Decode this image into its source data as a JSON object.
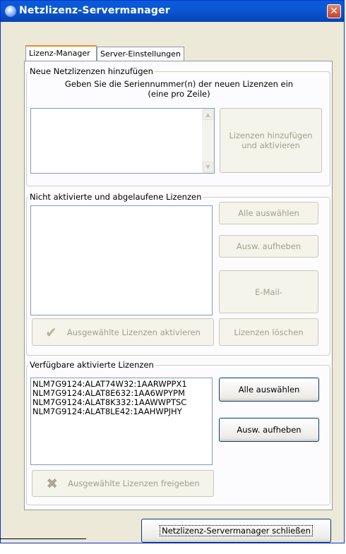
{
  "window": {
    "title": "Netzlizenz-Servermanager",
    "close_glyph": "✕"
  },
  "tabs": [
    {
      "label": "Lizenz-Manager",
      "active": true
    },
    {
      "label": "Server-Einstellungen",
      "active": false
    }
  ],
  "new_licenses": {
    "legend": "Neue Netzlizenzen hinzufügen",
    "instruction_line1": "Geben Sie die Seriennummer(n) der neuen Lizenzen ein",
    "instruction_line2": "(eine pro Zeile)",
    "input_value": "",
    "add_button_line1": "Lizenzen hinzufügen",
    "add_button_line2": "und aktivieren"
  },
  "inactive_licenses": {
    "legend": "Nicht aktivierte und abgelaufene Lizenzen",
    "items": [],
    "select_all_button": "Alle auswählen",
    "deselect_button": "Ausw. aufheben",
    "email_button": "E-Mail-",
    "activate_button": "Ausgewählte Lizenzen aktivieren",
    "delete_button": "Lizenzen löschen"
  },
  "active_licenses": {
    "legend": "Verfügbare aktivierte Lizenzen",
    "items": [
      "NLM7G9124:ALAT74W32:1AARWPPX1",
      "NLM7G9124:ALAT8E632:1AA6WPYPM",
      "NLM7G9124:ALAT8K332:1AAWWPTSC",
      "NLM7G9124:ALAT8LE42:1AAHWPJHY"
    ],
    "select_all_button": "Alle auswählen",
    "deselect_button": "Ausw. aufheben",
    "release_button": "Ausgewählte Lizenzen freigeben"
  },
  "footer": {
    "close_button": "Netzlizenz-Servermanager schließen"
  },
  "icons": {
    "app": "server-license-icon",
    "check": "checkmark-icon",
    "release": "x-mark-icon",
    "scroll_up": "scroll-up-arrow-icon",
    "scroll_down": "scroll-down-arrow-icon"
  },
  "colors": {
    "titlebar": "#0a5bd8",
    "window_bg": "#ece9d8",
    "disabled_text": "#a19e8e",
    "close_button": "#c8412a"
  }
}
